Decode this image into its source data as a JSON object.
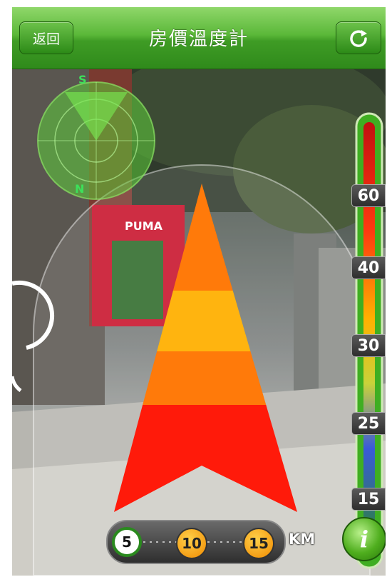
{
  "navbar": {
    "title": "房價溫度計",
    "back_label": "返回",
    "refresh_icon": "refresh-icon"
  },
  "radar": {
    "north_label": "N",
    "south_label": "S"
  },
  "thermometer": {
    "ticks": [
      "60",
      "40",
      "30",
      "25",
      "15"
    ]
  },
  "storefront": {
    "sign_text": "PUMA"
  },
  "distance": {
    "options": [
      "5",
      "10",
      "15"
    ],
    "selected": "5",
    "unit": "KM"
  },
  "info": {
    "label": "i"
  },
  "colors": {
    "nav_green": "#3f9c25",
    "arrow_red": "#ff1a0a",
    "arrow_orange": "#ff7a0a",
    "arrow_yellow": "#ffb40f",
    "radar_green": "#5ccd3a"
  }
}
